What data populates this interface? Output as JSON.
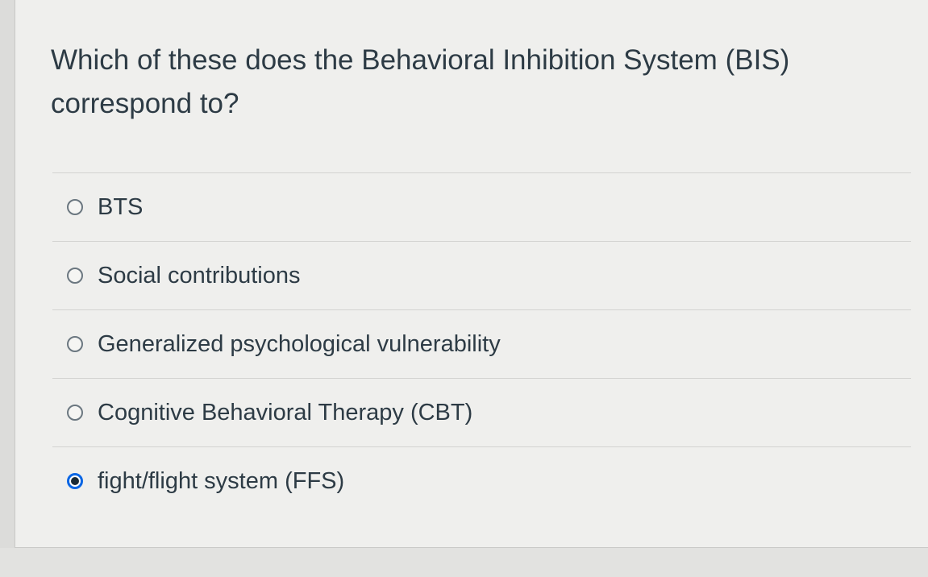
{
  "question": {
    "text": "Which of these does the Behavioral Inhibition System (BIS) correspond to?"
  },
  "answers": [
    {
      "label": "BTS",
      "selected": false
    },
    {
      "label": "Social contributions",
      "selected": false
    },
    {
      "label": "Generalized psychological vulnerability",
      "selected": false
    },
    {
      "label": "Cognitive Behavioral Therapy (CBT)",
      "selected": false
    },
    {
      "label": "fight/flight system (FFS)",
      "selected": true
    }
  ],
  "colors": {
    "text": "#2d3b45",
    "selected_ring": "#0b66e4",
    "divider": "#d3d3d1"
  }
}
